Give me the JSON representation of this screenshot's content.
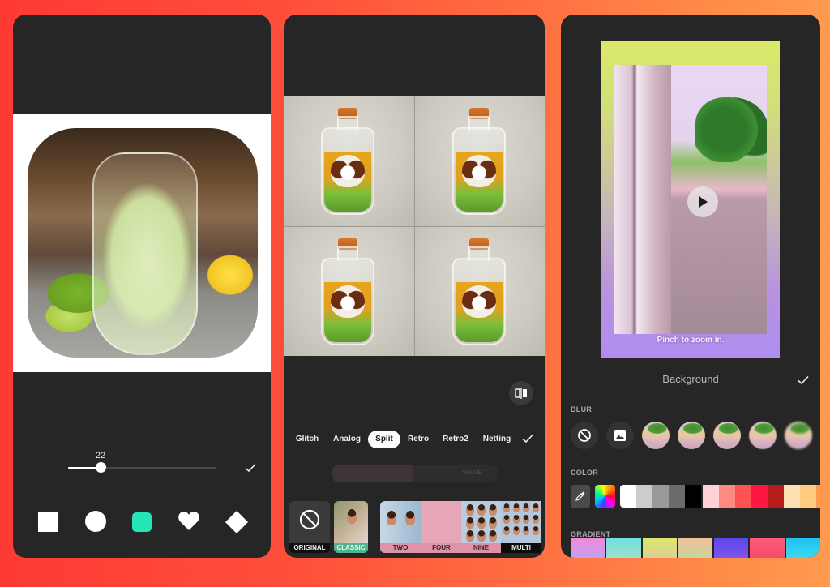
{
  "screen1": {
    "slider": {
      "label": "22",
      "value": 22,
      "min": 0,
      "max": 100
    },
    "confirm_icon": "check-icon",
    "shapes": [
      {
        "name": "square",
        "selected": false
      },
      {
        "name": "circle",
        "selected": false
      },
      {
        "name": "rounded-square",
        "selected": true
      },
      {
        "name": "heart",
        "selected": false
      },
      {
        "name": "diamond",
        "selected": false
      }
    ],
    "accent_color": "#23e6b4"
  },
  "screen2": {
    "effect_tabs": [
      "Glitch",
      "Analog",
      "Split",
      "Retro",
      "Retro2",
      "Netting"
    ],
    "active_tab": "Split",
    "value_label": "VALUE",
    "value_fraction": 0.49,
    "presets": [
      {
        "label": "ORIGINAL"
      },
      {
        "label": "CLASSIC"
      },
      {
        "label": "TWO"
      },
      {
        "label": "FOUR"
      },
      {
        "label": "NINE"
      },
      {
        "label": "MULTI"
      }
    ],
    "compare_icon": "compare-split-icon"
  },
  "screen3": {
    "hint": "Pinch to zoom in.",
    "panel_title": "Background",
    "sections": {
      "blur": "BLUR",
      "color": "COLOR",
      "gradient": "GRADIENT"
    },
    "color_swatches": [
      "#ffffff",
      "#cccccc",
      "#999999",
      "#6b6b6b",
      "#000000",
      "#ffd0d6",
      "#ff8a80",
      "#ff5252",
      "#ff1744",
      "#b71c1c",
      "#ffe0b2",
      "#ffcc80",
      "#ff9a4a"
    ],
    "gradients": [
      [
        "#f088dc",
        "#b6a8f0"
      ],
      [
        "#6ee0dc",
        "#a8e0c8"
      ],
      [
        "#d8e86c",
        "#e0c8a0"
      ],
      [
        "#f2c098",
        "#b8dca0"
      ],
      [
        "#5a48e8",
        "#8a58f0"
      ],
      [
        "#ff5a78",
        "#f04868"
      ],
      [
        "#20c0f0",
        "#40e0f0"
      ]
    ]
  }
}
